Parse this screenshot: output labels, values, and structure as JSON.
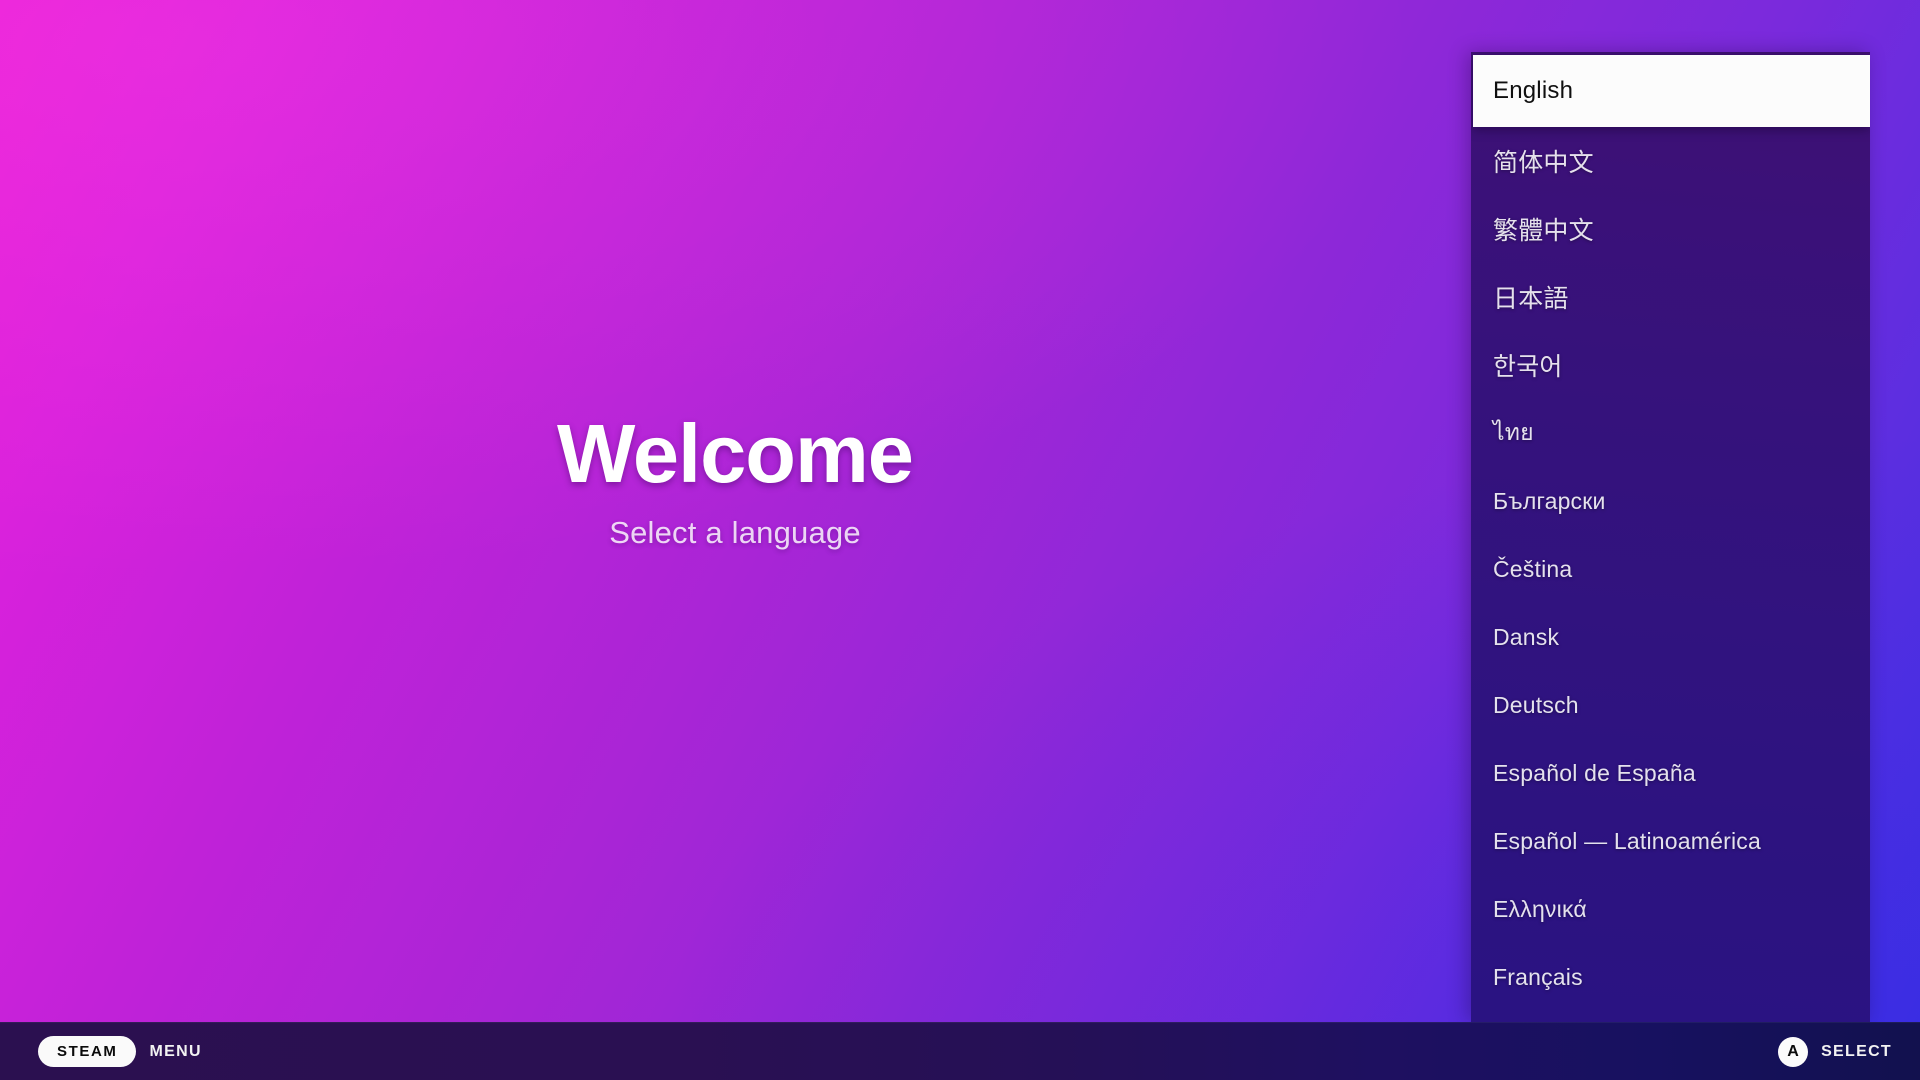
{
  "screen": {
    "title": "Welcome",
    "subtitle": "Select a language",
    "background_start": "#E81FD8",
    "background_end": "#4230E2"
  },
  "language_panel": {
    "selected_language": "English",
    "panel_bg_top": "#3F1173",
    "panel_bg_bottom": "#2A1382",
    "items": [
      {
        "label": "English",
        "selected": true,
        "cjk": false
      },
      {
        "label": "简体中文",
        "selected": false,
        "cjk": true
      },
      {
        "label": "繁體中文",
        "selected": false,
        "cjk": true
      },
      {
        "label": "日本語",
        "selected": false,
        "cjk": true
      },
      {
        "label": "한국어",
        "selected": false,
        "cjk": true
      },
      {
        "label": "ไทย",
        "selected": false,
        "cjk": false
      },
      {
        "label": "Български",
        "selected": false,
        "cjk": false
      },
      {
        "label": "Čeština",
        "selected": false,
        "cjk": false
      },
      {
        "label": "Dansk",
        "selected": false,
        "cjk": false
      },
      {
        "label": "Deutsch",
        "selected": false,
        "cjk": false
      },
      {
        "label": "Español de España",
        "selected": false,
        "cjk": false
      },
      {
        "label": "Español — Latinoamérica",
        "selected": false,
        "cjk": false
      },
      {
        "label": "Ελληνικά",
        "selected": false,
        "cjk": false
      },
      {
        "label": "Français",
        "selected": false,
        "cjk": false
      }
    ]
  },
  "bottom_bar": {
    "steam_label": "STEAM",
    "menu_label": "MENU",
    "select_button_glyph": "A",
    "select_label": "SELECT"
  }
}
